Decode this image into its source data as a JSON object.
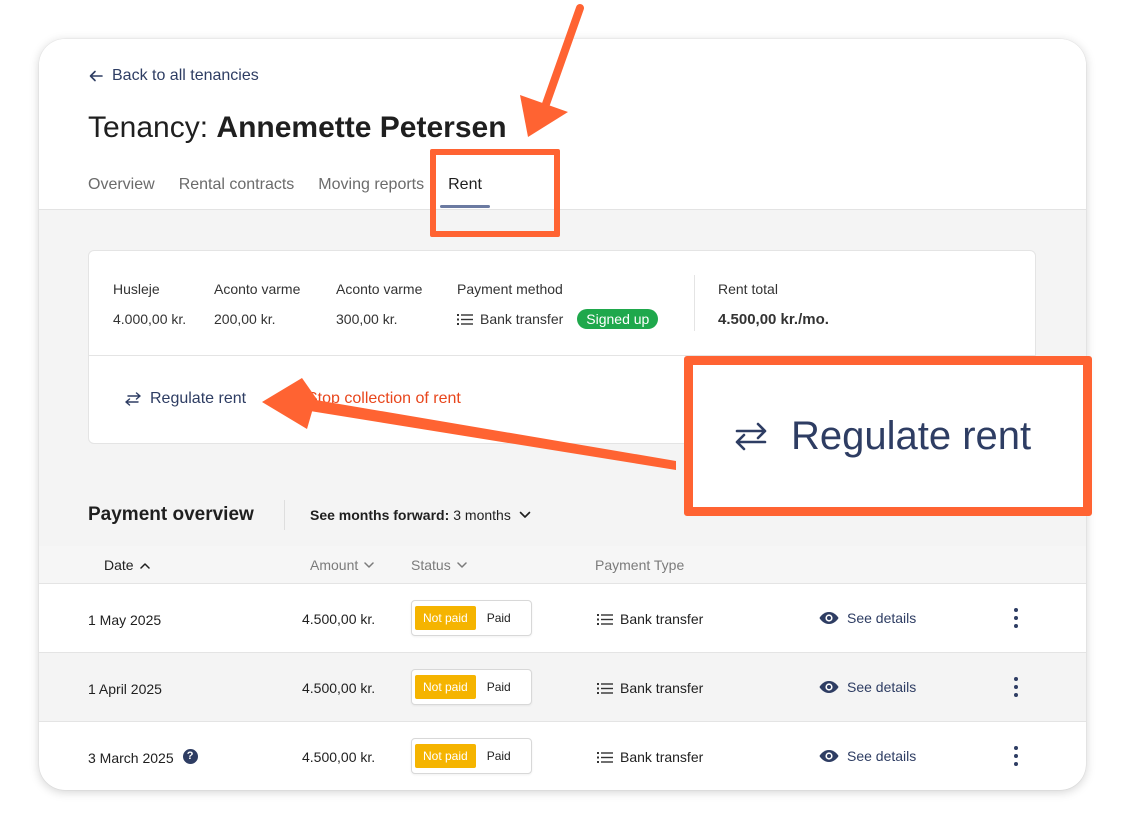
{
  "header": {
    "back_label": "Back to all tenancies",
    "title_prefix": "Tenancy:",
    "title_name": "Annemette Petersen",
    "tabs": [
      {
        "label": "Overview"
      },
      {
        "label": "Rental contracts"
      },
      {
        "label": "Moving reports"
      },
      {
        "label": "Rent"
      }
    ]
  },
  "rent_summary": {
    "fields": [
      {
        "label": "Husleje",
        "value": "4.000,00 kr."
      },
      {
        "label": "Aconto varme",
        "value": "200,00 kr."
      },
      {
        "label": "Aconto varme",
        "value": "300,00 kr."
      }
    ],
    "payment_method": {
      "label": "Payment method",
      "value": "Bank transfer",
      "badge": "Signed up"
    },
    "rent_total": {
      "label": "Rent total",
      "value": "4.500,00 kr./mo."
    },
    "actions": {
      "regulate": "Regulate rent",
      "stop": "Stop collection of rent"
    }
  },
  "payment_overview": {
    "title": "Payment overview",
    "filter_label": "See months forward:",
    "filter_value": "3 months",
    "columns": {
      "date": "Date",
      "amount": "Amount",
      "status": "Status",
      "payment_type": "Payment Type"
    },
    "rows": [
      {
        "date": "1 May 2025",
        "amount": "4.500,00 kr.",
        "status_not_paid": "Not paid",
        "status_paid": "Paid",
        "type": "Bank transfer",
        "details": "See details"
      },
      {
        "date": "1 April 2025",
        "amount": "4.500,00 kr.",
        "status_not_paid": "Not paid",
        "status_paid": "Paid",
        "type": "Bank transfer",
        "details": "See details"
      },
      {
        "date": "3 March 2025",
        "amount": "4.500,00 kr.",
        "status_not_paid": "Not paid",
        "status_paid": "Paid",
        "type": "Bank transfer",
        "details": "See details",
        "help": "?"
      }
    ]
  },
  "annotation": {
    "zoom_label": "Regulate rent"
  },
  "colors": {
    "accent": "#2e3d63",
    "highlight": "#ff6332",
    "success": "#1fa84c",
    "warning": "#f5b400",
    "danger": "#e8461c"
  }
}
